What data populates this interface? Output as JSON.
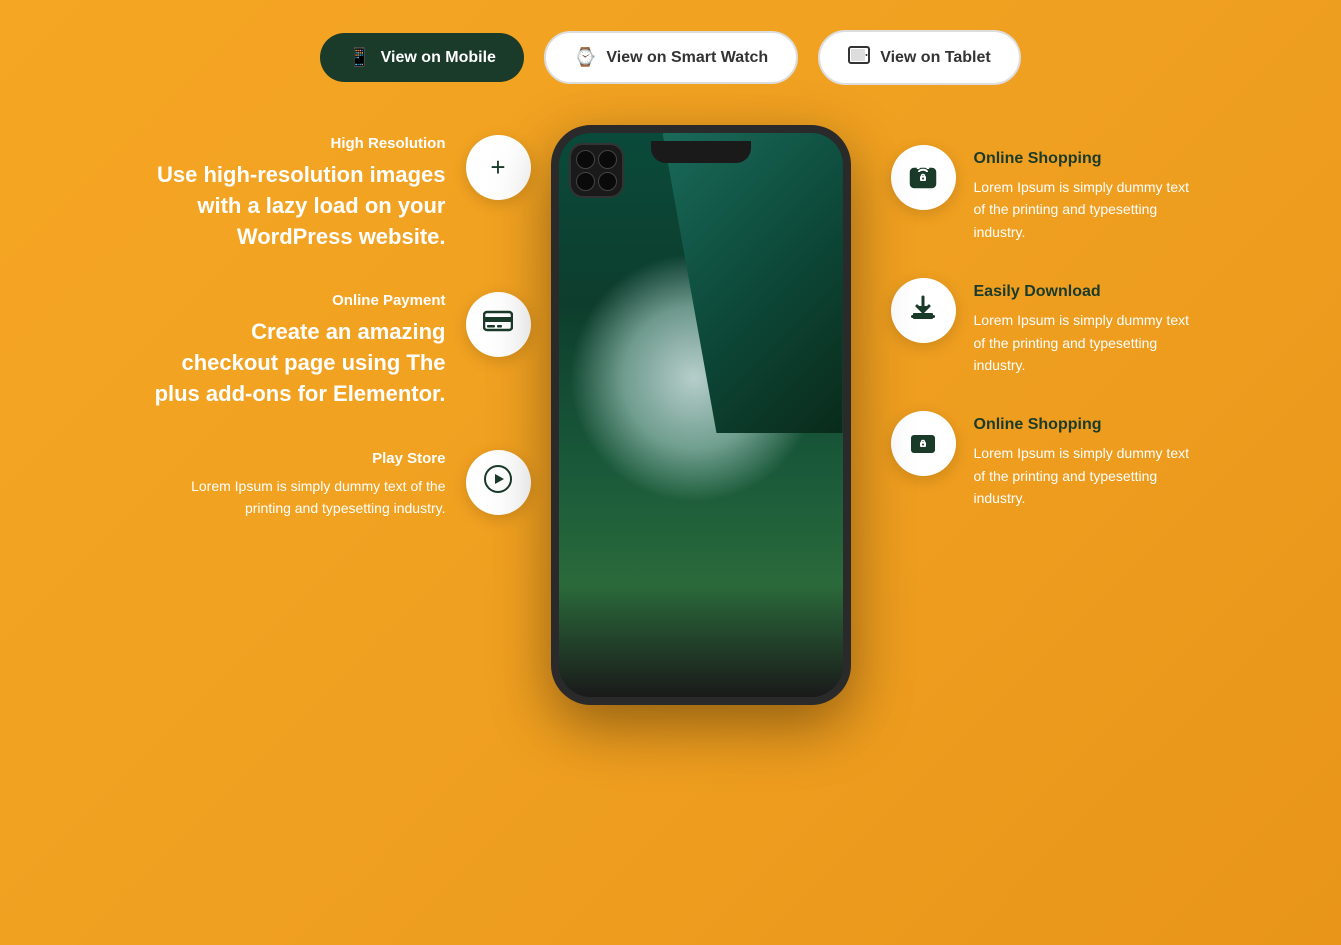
{
  "nav": {
    "mobile": {
      "label": "View on Mobile",
      "active": true
    },
    "smartwatch": {
      "label": "View on Smart Watch",
      "active": false
    },
    "tablet": {
      "label": "View on Tablet",
      "active": false
    }
  },
  "left_features": [
    {
      "title": "High Resolution",
      "description_parts": [
        {
          "text": "Use high-resolution images with a lazy load on your ",
          "bold": false
        },
        {
          "text": "WordPress website.",
          "bold": true
        }
      ],
      "icon": "+"
    },
    {
      "title": "Online Payment",
      "description_parts": [
        {
          "text": "Create an amazing ",
          "bold": false
        },
        {
          "text": "checkout page",
          "bold": true
        },
        {
          "text": " using The plus add-ons for ",
          "bold": false
        },
        {
          "text": "Elementor.",
          "bold": true
        }
      ],
      "icon": "credit-card"
    },
    {
      "title": "Play Store",
      "description": "Lorem Ipsum is simply dummy text of the printing and typesetting industry.",
      "icon": "play-store"
    }
  ],
  "right_features": [
    {
      "title": "Online Shopping",
      "description": "Lorem Ipsum is simply dummy text of the printing and typesetting industry.",
      "icon": "shopping-bag"
    },
    {
      "title": "Easily Download",
      "description": "Lorem Ipsum is simply dummy text of the printing and typesetting industry.",
      "icon": "download"
    },
    {
      "title": "Online Shopping",
      "description": "Lorem Ipsum is simply dummy text of the printing and typesetting industry.",
      "icon": "shopping-bag"
    }
  ]
}
